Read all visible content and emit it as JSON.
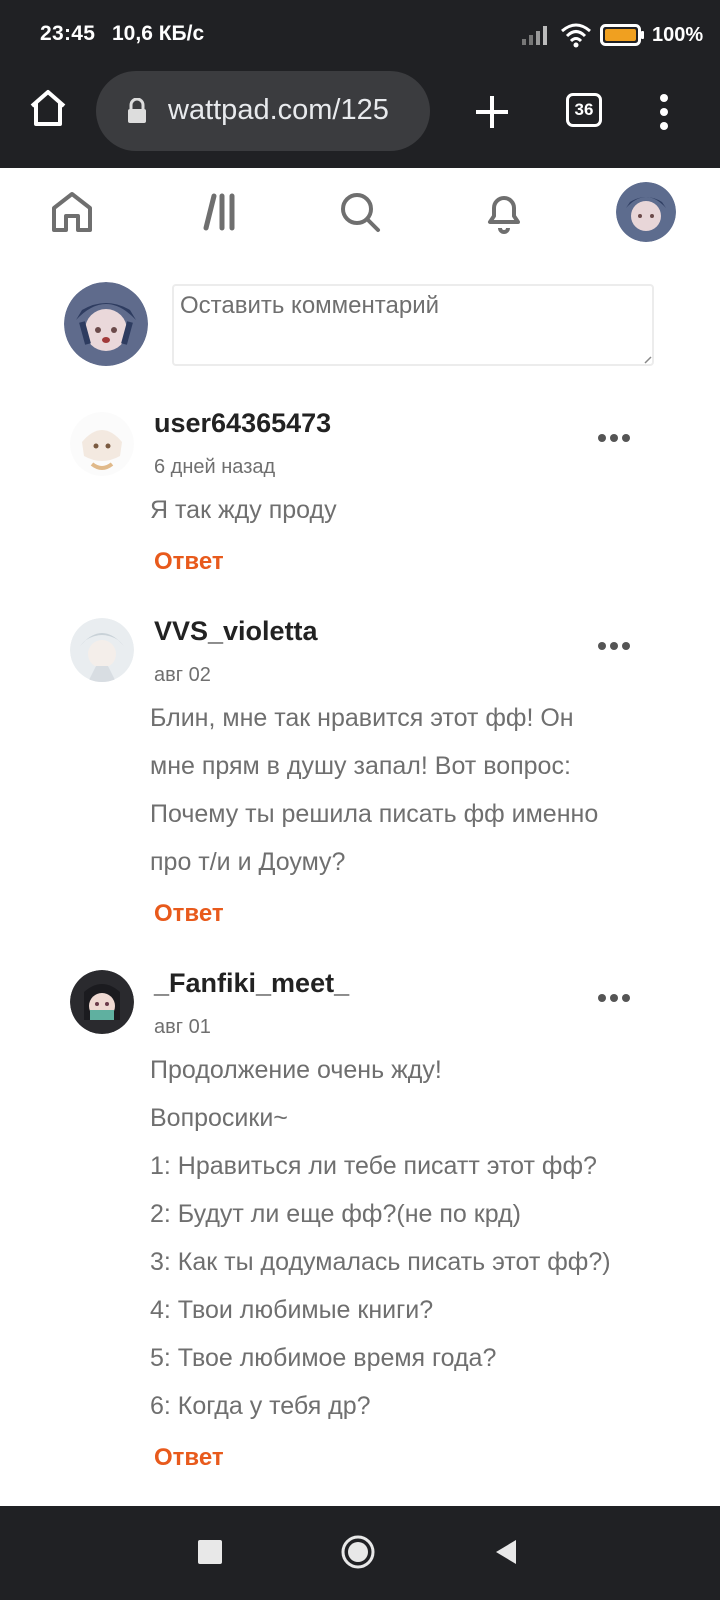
{
  "status_bar": {
    "time": "23:45",
    "speed": "10,6 КБ/с",
    "battery": "100%"
  },
  "browser": {
    "url": "wattpad.com/125",
    "tab_count": "36"
  },
  "comment_input": {
    "placeholder": "Оставить комментарий"
  },
  "comments": [
    {
      "username": "user64365473",
      "date": "6 дней назад",
      "lines": [
        "Я так жду проду"
      ],
      "reply": "Ответ"
    },
    {
      "username": "VVS_violetta",
      "date": "авг 02",
      "lines": [
        "Блин, мне так нравится этот фф! Он",
        "мне прям в душу запал! Вот вопрос:",
        "Почему ты решила писать фф именно",
        "про т/и и Доуму?"
      ],
      "reply": "Ответ"
    },
    {
      "username": "_Fanfiki_meet_",
      "date": "авг 01",
      "lines": [
        "Продолжение очень жду!",
        "Вопросики~",
        "1: Нравиться ли тебе писатт этот фф?",
        "2: Будут ли еще фф?(не по крд)",
        "3: Как ты додумалась писать этот фф?)",
        "4: Твои любимые книги?",
        "5: Твое любимое время года?",
        "6: Когда у тебя др?"
      ],
      "reply": "Ответ"
    }
  ],
  "colors": {
    "reply_accent": "#e85a1c",
    "chrome_dark": "#202124"
  }
}
